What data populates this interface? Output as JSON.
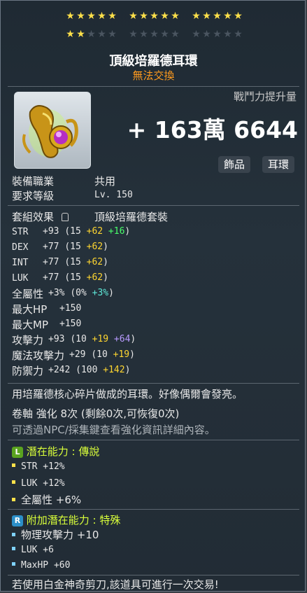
{
  "stars": {
    "row1_filled": 15,
    "row1_total": 15,
    "row2_filled": 2,
    "row2_total": 15
  },
  "item_name": "頂級培羅德耳環",
  "trade_status": "無法交換",
  "cp_label": "戰鬥力提升量",
  "cp_value": "+ 163萬 6644",
  "tags": [
    "飾品",
    "耳環"
  ],
  "req": {
    "job_label": "裝備職業",
    "job_value": "共用",
    "level_label": "要求等級",
    "level_value": "Lv. 150"
  },
  "set": {
    "label": "套組效果",
    "name": "頂級培羅德套裝"
  },
  "stats": [
    {
      "name": "STR",
      "total": "+93",
      "base": "(15",
      "star": "+62",
      "extra": "+16",
      "extra_color": "green",
      "close": ")"
    },
    {
      "name": "DEX",
      "total": "+77",
      "base": "(15",
      "star": "+62",
      "extra": "",
      "extra_color": "",
      "close": ")"
    },
    {
      "name": "INT",
      "total": "+77",
      "base": "(15",
      "star": "+62",
      "extra": "",
      "extra_color": "",
      "close": ")"
    },
    {
      "name": "LUK",
      "total": "+77",
      "base": "(15",
      "star": "+62",
      "extra": "",
      "extra_color": "",
      "close": ")"
    },
    {
      "name": "全屬性",
      "total": "+3%",
      "base": "(0%",
      "star": "",
      "extra": "+3%",
      "extra_color": "cyan",
      "close": ")"
    },
    {
      "name": "最大HP",
      "total": "+150",
      "base": "",
      "star": "",
      "extra": "",
      "extra_color": "",
      "close": ""
    },
    {
      "name": "最大MP",
      "total": "+150",
      "base": "",
      "star": "",
      "extra": "",
      "extra_color": "",
      "close": ""
    },
    {
      "name": "攻擊力",
      "total": "+93",
      "base": "(10",
      "star": "+19",
      "extra": "+64",
      "extra_color": "purple",
      "close": ")"
    },
    {
      "name": "魔法攻擊力",
      "total": "+29",
      "base": "(10",
      "star": "+19",
      "extra": "",
      "extra_color": "",
      "close": ")"
    },
    {
      "name": "防禦力",
      "total": "+242",
      "base": "(100",
      "star": "+142",
      "extra": "",
      "extra_color": "",
      "close": ")"
    }
  ],
  "description": "用培羅德核心碎片做成的耳環。好像偶爾會發亮。",
  "scroll": "卷軸 強化 8次 (剩餘0次,可恢復0次)",
  "enhance_hint": "可透過NPC/採集鍵查看強化資訊詳細內容。",
  "potential": {
    "badge": "L",
    "title": "潛在能力 : 傳說",
    "lines": [
      "STR +12%",
      "LUK +12%",
      "全屬性 +6%"
    ]
  },
  "additional": {
    "badge": "R",
    "title": "附加潛在能力 : 特殊",
    "lines": [
      "物理攻擊力 +10",
      "LUK +6",
      "MaxHP +60"
    ]
  },
  "footer": "若使用白金神奇剪刀,該道具可進行一次交易!",
  "colors": {
    "legend_badge": "#5aa31f",
    "rare_badge": "#2c8fc8",
    "legend_bullet": "#ffe24a",
    "rare_bullet": "#7fd2ff"
  }
}
